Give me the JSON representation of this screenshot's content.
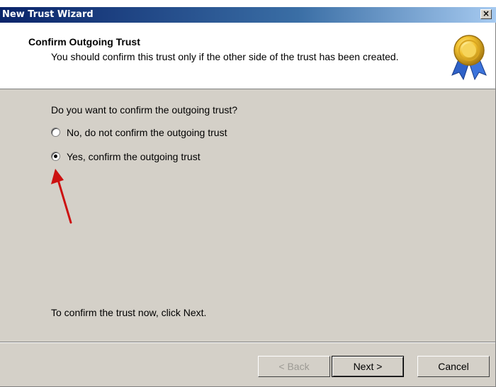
{
  "window": {
    "title": "New Trust Wizard",
    "close_glyph": "×"
  },
  "header": {
    "title": "Confirm Outgoing Trust",
    "subtitle": "You should confirm this trust only if the other side of the trust has been created.",
    "icon": "award-ribbon-icon"
  },
  "content": {
    "question": "Do you want to confirm the outgoing trust?",
    "options": [
      {
        "label": "No, do not confirm the outgoing trust",
        "selected": false
      },
      {
        "label": "Yes, confirm the outgoing trust",
        "selected": true
      }
    ],
    "instruction": "To confirm the trust now, click Next."
  },
  "annotation": {
    "icon": "red-arrow-icon",
    "color": "#cc1111"
  },
  "buttons": {
    "back": "< Back",
    "next": "Next >",
    "cancel": "Cancel"
  }
}
